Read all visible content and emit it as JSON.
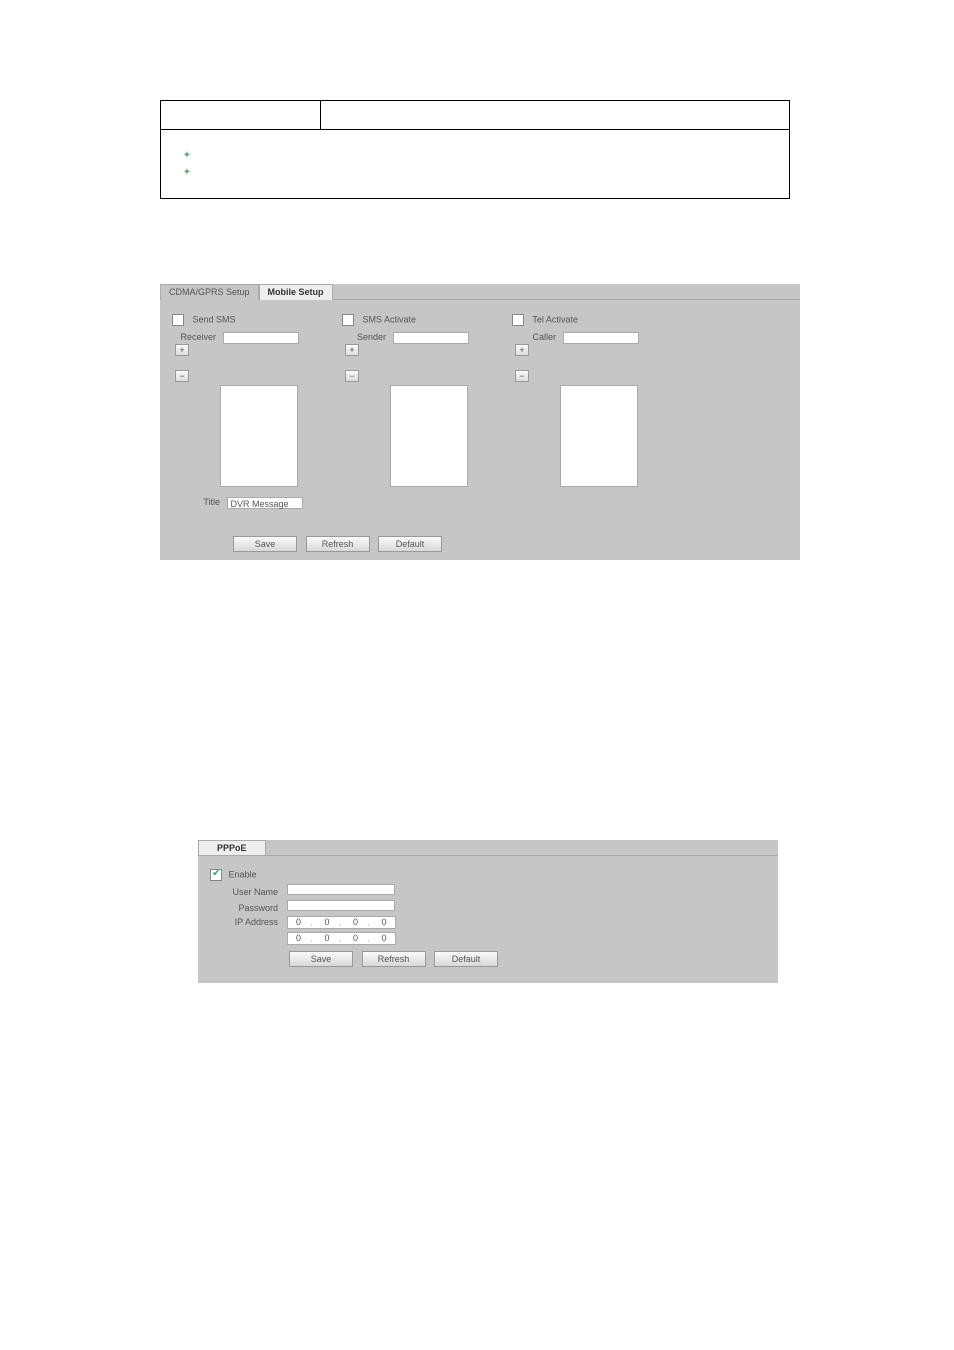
{
  "info_table": {
    "r1c1": "",
    "r1c2": "",
    "note1": "",
    "note2": ""
  },
  "mobile_panel": {
    "tab_inactive": "CDMA/GPRS Setup",
    "tab_active": "Mobile Setup",
    "groups": [
      {
        "title": "Send SMS",
        "label": "Receiver",
        "checked": false,
        "has_title_row": true
      },
      {
        "title": "SMS Activate",
        "label": "Sender",
        "checked": false,
        "has_title_row": false
      },
      {
        "title": "Tel Activate",
        "label": "Caller",
        "checked": false,
        "has_title_row": false
      }
    ],
    "title_label": "Title",
    "title_value": "DVR Message",
    "add_btn": "+",
    "del_btn": "−",
    "buttons": [
      "Save",
      "Refresh",
      "Default"
    ]
  },
  "pppoe_panel": {
    "tab": "PPPoE",
    "enable_label": "Enable",
    "enable_checked": true,
    "rows": {
      "username_label": "User Name",
      "password_label": "Password",
      "ip_label": "IP Address"
    },
    "ip1": [
      "0",
      "0",
      "0",
      "0"
    ],
    "ip2": [
      "0",
      "0",
      "0",
      "0"
    ],
    "buttons": [
      "Save",
      "Refresh",
      "Default"
    ]
  }
}
